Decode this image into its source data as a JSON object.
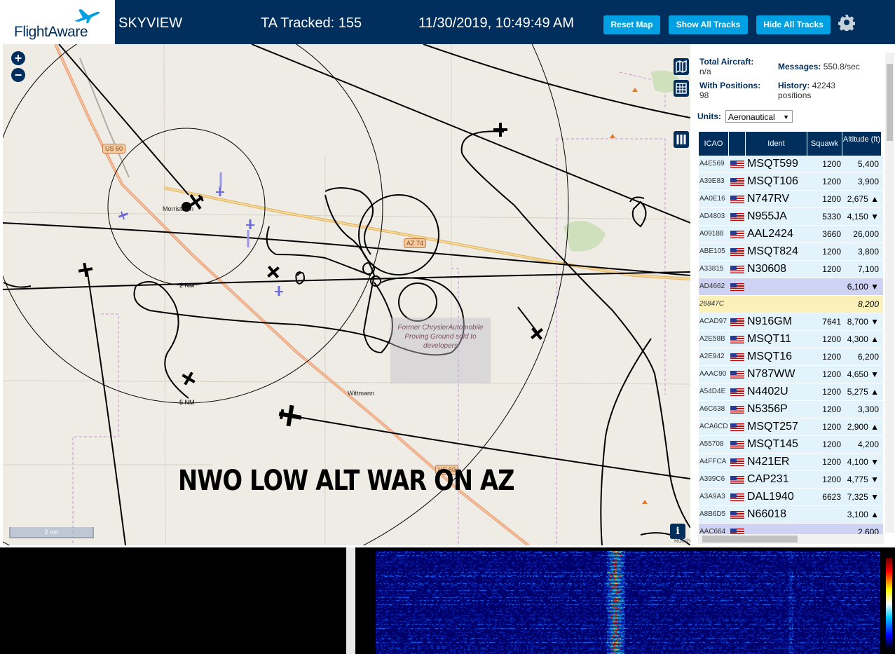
{
  "header": {
    "brand": "FlightAware",
    "app_title": "SKYVIEW",
    "tracked": "TA Tracked: 155",
    "datetime": "11/30/2019, 10:49:49 AM",
    "buttons": {
      "reset": "Reset Map",
      "show": "Show All Tracks",
      "hide": "Hide All Tracks"
    },
    "settings_icon": "gear-icon"
  },
  "map": {
    "zoom_in": "+",
    "zoom_out": "−",
    "ring_labels": {
      "inner": "2 NM",
      "outer": "5 NM"
    },
    "places": {
      "morristown": "Morristown",
      "wittmann": "Wittmann",
      "runch": "Runch"
    },
    "shields": {
      "us60_a": "US 60",
      "az74": "AZ 74",
      "us60_b": "US 60"
    },
    "proving_ground": "Former ChryslerAutomobile Proving Ground sold to developers",
    "scale": "2 nm",
    "banner": "NWO LOW ALT WAR ON AZ",
    "info": "i",
    "tool_icons": [
      "map-icon",
      "grid-icon",
      "columns-icon"
    ]
  },
  "sidebar": {
    "stats": {
      "total_label": "Total Aircraft:",
      "total_value": "n/a",
      "positions_label": "With Positions:",
      "positions_value": "98",
      "messages_label": "Messages:",
      "messages_value": "550.8/sec",
      "history_label": "History:",
      "history_value": "42243 positions"
    },
    "units_label": "Units:",
    "units_value": "Aeronautical",
    "table": {
      "headers": [
        "ICAO",
        "",
        "Ident",
        "Squawk",
        "Altitude (ft)"
      ],
      "rows": [
        {
          "icao": "A4E569",
          "ident": "MSQT599",
          "squawk": "1200",
          "alt": "5,400",
          "flag": true,
          "style": "normal"
        },
        {
          "icao": "A39E83",
          "ident": "MSQT106",
          "squawk": "1200",
          "alt": "3,900",
          "flag": true,
          "style": "normal"
        },
        {
          "icao": "AA0E16",
          "ident": "N747RV",
          "squawk": "1200",
          "alt": "2,675 ▲",
          "flag": true,
          "style": "normal"
        },
        {
          "icao": "AD4803",
          "ident": "N955JA",
          "squawk": "5330",
          "alt": "4,150 ▼",
          "flag": true,
          "style": "normal"
        },
        {
          "icao": "A09188",
          "ident": "AAL2424",
          "squawk": "3660",
          "alt": "26,000",
          "flag": true,
          "style": "normal"
        },
        {
          "icao": "ABE105",
          "ident": "MSQT824",
          "squawk": "1200",
          "alt": "3,800",
          "flag": true,
          "style": "normal"
        },
        {
          "icao": "A33815",
          "ident": "N30608",
          "squawk": "1200",
          "alt": "7,100",
          "flag": true,
          "style": "normal"
        },
        {
          "icao": "AD4662",
          "ident": "",
          "squawk": "",
          "alt": "6,100 ▼",
          "flag": true,
          "style": "purple"
        },
        {
          "icao": "26847C",
          "ident": "",
          "squawk": "",
          "alt": "8,200",
          "flag": false,
          "style": "yellow"
        },
        {
          "icao": "ACAD97",
          "ident": "N916GM",
          "squawk": "7641",
          "alt": "8,700 ▼",
          "flag": true,
          "style": "normal"
        },
        {
          "icao": "A2E58B",
          "ident": "MSQT11",
          "squawk": "1200",
          "alt": "4,300 ▲",
          "flag": true,
          "style": "normal"
        },
        {
          "icao": "A2E942",
          "ident": "MSQT16",
          "squawk": "1200",
          "alt": "6,200",
          "flag": true,
          "style": "normal"
        },
        {
          "icao": "AAAC90",
          "ident": "N787WW",
          "squawk": "1200",
          "alt": "4,650 ▼",
          "flag": true,
          "style": "normal"
        },
        {
          "icao": "A54D4E",
          "ident": "N4402U",
          "squawk": "1200",
          "alt": "5,275 ▲",
          "flag": true,
          "style": "normal"
        },
        {
          "icao": "A6C638",
          "ident": "N5356P",
          "squawk": "1200",
          "alt": "3,300",
          "flag": true,
          "style": "normal"
        },
        {
          "icao": "ACA6CD",
          "ident": "MSQT257",
          "squawk": "1200",
          "alt": "2,900 ▲",
          "flag": true,
          "style": "normal"
        },
        {
          "icao": "A55708",
          "ident": "MSQT145",
          "squawk": "1200",
          "alt": "4,200",
          "flag": true,
          "style": "normal"
        },
        {
          "icao": "A4FFCA",
          "ident": "N421ER",
          "squawk": "1200",
          "alt": "4,100 ▼",
          "flag": true,
          "style": "normal"
        },
        {
          "icao": "A399C6",
          "ident": "CAP231",
          "squawk": "1200",
          "alt": "4,775 ▼",
          "flag": true,
          "style": "normal"
        },
        {
          "icao": "A3A9A3",
          "ident": "DAL1940",
          "squawk": "6623",
          "alt": "7,325 ▼",
          "flag": true,
          "style": "normal"
        },
        {
          "icao": "A8B6D5",
          "ident": "N66018",
          "squawk": "",
          "alt": "3,100 ▲",
          "flag": true,
          "style": "normal"
        },
        {
          "icao": "AAC664",
          "ident": "",
          "squawk": "",
          "alt": "2,600",
          "flag": true,
          "style": "purple"
        }
      ]
    }
  },
  "colors": {
    "header_bg": "#002f5d",
    "button_bg": "#00a0e2",
    "row_bg": "#e3f3fc",
    "row_purple": "#cfd3f3",
    "row_yellow": "#fbf0b9",
    "track": "#000000",
    "road": "#f0a070"
  }
}
